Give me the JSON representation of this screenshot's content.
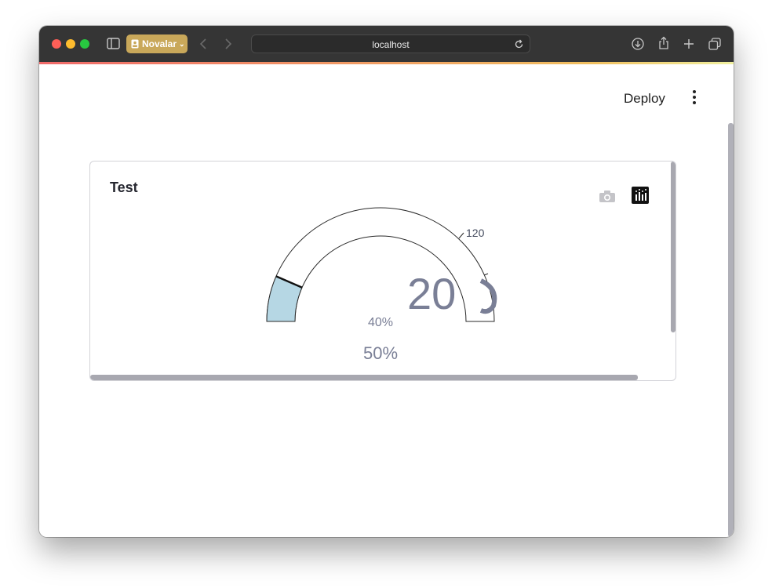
{
  "browser": {
    "tab_label": "Novalar",
    "url": "localhost"
  },
  "app": {
    "deploy_label": "Deploy"
  },
  "card": {
    "title": "Test"
  },
  "gauge": {
    "big_value": "20",
    "tick_label": "120",
    "delta_label": "40%",
    "sub_value": "50%",
    "fill_fraction": 0.13,
    "fill_color": "#b6d7e4",
    "number_color": "#7a7f96"
  },
  "colors": {
    "titlebar": "#353535",
    "card_border": "#d3d3d8"
  }
}
